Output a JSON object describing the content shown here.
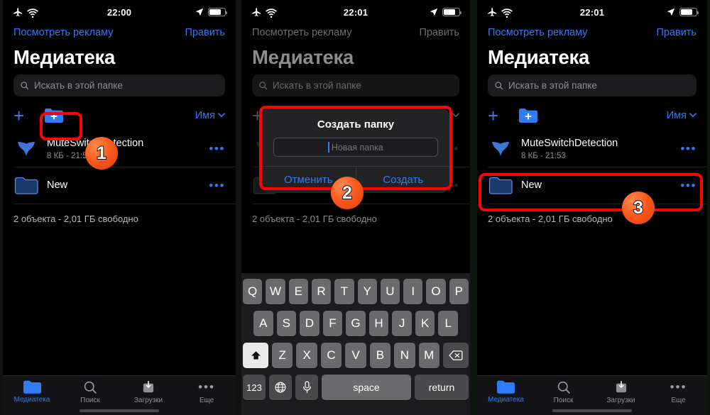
{
  "status_bar": {
    "time_1": "22:00",
    "time_2": "22:01",
    "time_3": "22:01",
    "airplane_icon": "airplane-mode-icon",
    "wifi_icon": "wifi-icon",
    "location_icon": "location-arrow-icon",
    "battery_icon": "battery-icon"
  },
  "nav": {
    "left_link": "Посмотреть рекламу",
    "right_link": "Править"
  },
  "header": {
    "title": "Медиатека"
  },
  "search": {
    "placeholder": "Искать в этой папке",
    "icon": "search-icon"
  },
  "toolbar": {
    "add_icon": "plus-icon",
    "new_folder_icon": "new-folder-icon",
    "sort_label": "Имя",
    "sort_chevron": "chevron-down-icon"
  },
  "files": [
    {
      "name": "MuteSwitchDetection",
      "subtitle": "8 КБ - 21:53",
      "icon": "swift-file-icon",
      "more_icon": "more-ellipsis-icon"
    },
    {
      "name": "New",
      "subtitle": "",
      "icon": "folder-icon",
      "more_icon": "more-ellipsis-icon"
    }
  ],
  "status_line": "2 объекта  -  2,01 ГБ свободно",
  "tabbar": [
    {
      "label": "Медиатека",
      "icon": "folder-icon",
      "active": true
    },
    {
      "label": "Поиск",
      "icon": "search-icon",
      "active": false
    },
    {
      "label": "Загрузки",
      "icon": "downloads-icon",
      "active": false
    },
    {
      "label": "Еще",
      "icon": "more-ellipsis-icon",
      "active": false
    }
  ],
  "modal": {
    "title": "Создать папку",
    "input_placeholder": "Новая папка",
    "input_value": "",
    "cancel_label": "Отменить",
    "create_label": "Создать"
  },
  "keyboard": {
    "row1": [
      "Q",
      "W",
      "E",
      "R",
      "T",
      "Y",
      "U",
      "I",
      "O",
      "P"
    ],
    "row2": [
      "A",
      "S",
      "D",
      "F",
      "G",
      "H",
      "J",
      "K",
      "L"
    ],
    "row3": [
      "Z",
      "X",
      "C",
      "V",
      "B",
      "N",
      "M"
    ],
    "shift_icon": "shift-up-arrow-icon",
    "backspace_icon": "backspace-delete-icon",
    "numbers_label": "123",
    "globe_icon": "globe-language-icon",
    "mic_icon": "microphone-icon",
    "space_label": "space",
    "return_label": "return"
  },
  "annotations": {
    "badge_1": "1",
    "badge_2": "2",
    "badge_3": "3",
    "highlight_color": "#fb0404",
    "badge_color": "#f8581c"
  }
}
